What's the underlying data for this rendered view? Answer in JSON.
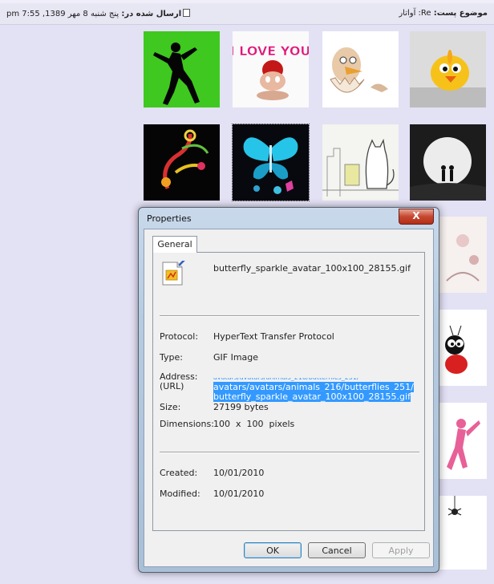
{
  "post": {
    "subject_label": "موضوع پست:",
    "subject_value": "Re: آواتار",
    "sent_label": "ارسال شده در:",
    "sent_value": "پنج شنبه 8 مهر 1389, 7:55 pm"
  },
  "avatars": [
    {
      "name": "dancing-silhouette-avatar",
      "style": "green"
    },
    {
      "name": "i-love-you-avatar",
      "style": "white"
    },
    {
      "name": "hatching-chick-avatar",
      "style": "white"
    },
    {
      "name": "yellow-chick-avatar",
      "style": "white"
    },
    {
      "name": "ornament-avatar",
      "style": "black"
    },
    {
      "name": "butterfly-sparkle-avatar",
      "style": "dark"
    },
    {
      "name": "sketch-cat-avatar",
      "style": "white"
    },
    {
      "name": "moon-couple-avatar",
      "style": "dark"
    }
  ],
  "dialog": {
    "title": "Properties",
    "close_symbol": "X",
    "tab_label": "General",
    "file_name": "butterfly_sparkle_avatar_100x100_28155.gif",
    "protocol_label": "Protocol:",
    "protocol_value": "HyperText Transfer Protocol",
    "type_label": "Type:",
    "type_value": "GIF Image",
    "address_label": "Address:",
    "address_label_2": "(URL)",
    "address_partial": "avatars/avatars/animals_216/butterflies_251/",
    "address_value": "avatars/avatars/animals_216/butterflies_251/butterfly_sparkle_avatar_100x100_28155.gif",
    "size_label": "Size:",
    "size_value": "27199 bytes",
    "dimensions_label": "Dimensions:",
    "dimensions_value": "100  x  100  pixels",
    "created_label": "Created:",
    "created_value": "10/01/2010",
    "modified_label": "Modified:",
    "modified_value": "10/01/2010",
    "ok_label": "OK",
    "cancel_label": "Cancel",
    "apply_label": "Apply"
  }
}
